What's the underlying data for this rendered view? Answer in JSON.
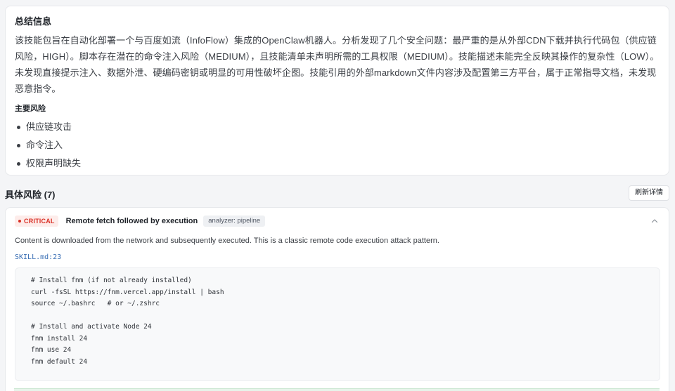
{
  "summary": {
    "title": "总结信息",
    "text": "该技能包旨在自动化部署一个与百度如流（InfoFlow）集成的OpenClaw机器人。分析发现了几个安全问题：最严重的是从外部CDN下载并执行代码包（供应链风险，HIGH）。脚本存在潜在的命令注入风险（MEDIUM），且技能清单未声明所需的工具权限（MEDIUM）。技能描述未能完全反映其操作的复杂性（LOW）。未发现直接提示注入、数据外泄、硬编码密钥或明显的可用性破坏企图。技能引用的外部markdown文件内容涉及配置第三方平台，属于正常指导文档，未发现恶意指令。",
    "risks_title": "主要风险",
    "risks": [
      "供应链攻击",
      "命令注入",
      "权限声明缺失"
    ]
  },
  "findings_section": {
    "title": "具体风险 (7)",
    "refresh_label": "刷新详情"
  },
  "finding": {
    "severity": "CRITICAL",
    "title": "Remote fetch followed by execution",
    "analyzer": "analyzer: pipeline",
    "description": "Content is downloaded from the network and subsequently executed. This is a classic remote code execution attack pattern.",
    "location": "SKILL.md:23",
    "code": [
      "# Install fnm (if not already installed)",
      "curl -fsSL https://fnm.vercel.app/install | bash",
      "source ~/.bashrc   # or ~/.zshrc",
      "",
      "# Install and activate Node 24",
      "fnm install 24",
      "fnm use 24",
      "fnm default 24"
    ]
  },
  "colors": {
    "critical": "#d93026",
    "critical_bg": "#fdecea",
    "link": "#3a6fb5",
    "page_bg": "#f4f5f7"
  },
  "icons": {
    "collapse": "chevron-up-icon",
    "severity": "dot-icon"
  }
}
